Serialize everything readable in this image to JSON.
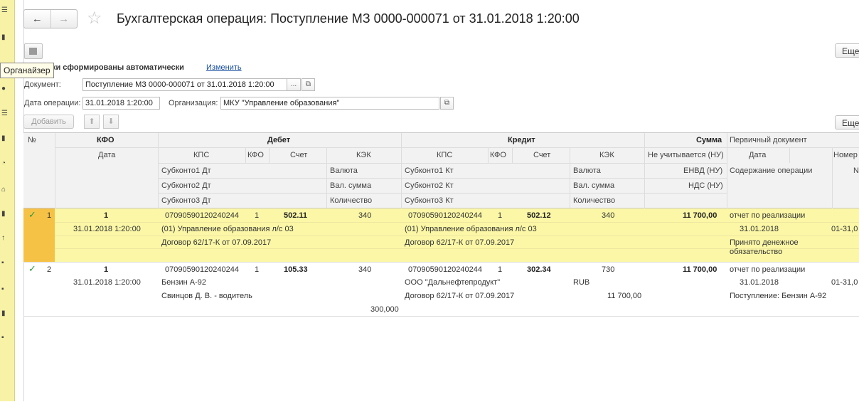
{
  "header": {
    "title": "Бухгалтерская операция: Поступление МЗ 0000-000071 от 31.01.2018 1:20:00",
    "back_icon": "←",
    "forward_icon": "→",
    "star_icon": "☆",
    "more_label": "Еще"
  },
  "tooltip": "Органайзер",
  "auto_text": "дки сформированы автоматически",
  "change_link": "Изменить",
  "form": {
    "document_label": "Документ:",
    "document_value": "Поступление МЗ 0000-000071 от 31.01.2018 1:20:00",
    "ellipsis": "...",
    "open_icon": "⧉",
    "date_label": "Дата операции:",
    "date_value": "31.01.2018  1:20:00",
    "org_label": "Организация:",
    "org_value": "МКУ \"Управление образования\""
  },
  "toolbar": {
    "add_label": "Добавить",
    "up_icon": "⬆",
    "down_icon": "⬇",
    "more_label": "Еще"
  },
  "columns": {
    "num": "№",
    "kfo": "КФО",
    "date": "Дата",
    "debit": "Дебет",
    "credit": "Кредит",
    "sum": "Сумма",
    "primary_doc": "Первичный документ",
    "kps": "КПС",
    "kfo_short": "КФО",
    "account": "Счет",
    "kek": "КЭК",
    "sub1_dt": "Субконто1 Дт",
    "sub2_dt": "Субконто2 Дт",
    "sub3_dt": "Субконто3 Дт",
    "sub1_kt": "Субконто1 Кт",
    "sub2_kt": "Субконто2 Кт",
    "sub3_kt": "Субконто3 Кт",
    "currency": "Валюта",
    "cur_sum": "Вал. сумма",
    "quantity": "Количество",
    "not_counted": "Не учитывается (НУ)",
    "envd": "ЕНВД (НУ)",
    "vat": "НДС (НУ)",
    "pd_date": "Дата",
    "pd_number": "Номер",
    "op_content": "Содержание операции",
    "n_short": "N"
  },
  "rows": [
    {
      "check": "✓",
      "num": "1",
      "kfo": "1",
      "date": "31.01.2018 1:20:00",
      "dt_kps": "07090590120240244",
      "dt_kfo": "1",
      "dt_account": "502.11",
      "dt_kek": "340",
      "dt_sub1": "(01) Управление образования л/с 03",
      "dt_sub2": "Договор 62/17-К от 07.09.2017",
      "dt_sub3": "",
      "dt_currency": "",
      "dt_cur_sum": "",
      "dt_quantity": "",
      "kt_kps": "07090590120240244",
      "kt_kfo": "1",
      "kt_account": "502.12",
      "kt_kek": "340",
      "kt_sub1": "(01) Управление образования л/с 03",
      "kt_sub2": "Договор 62/17-К от 07.09.2017",
      "kt_sub3": "",
      "kt_currency": "",
      "kt_cur_sum": "",
      "kt_quantity": "",
      "sum": "11 700,00",
      "pd_doc": "отчет по реализации",
      "pd_date": "31.01.2018",
      "pd_number": "01-31,0",
      "content1": "Принято денежное",
      "content2": "обязательство"
    },
    {
      "check": "✓",
      "num": "2",
      "kfo": "1",
      "date": "31.01.2018 1:20:00",
      "dt_kps": "07090590120240244",
      "dt_kfo": "1",
      "dt_account": "105.33",
      "dt_kek": "340",
      "dt_sub1": "Бензин А-92",
      "dt_sub2": "Свинцов Д. В. - водитель",
      "dt_quantity": "300,000",
      "kt_kps": "07090590120240244",
      "kt_kfo": "1",
      "kt_account": "302.34",
      "kt_kek": "730",
      "kt_sub1": "ООО \"Дальнефтепродукт\"",
      "kt_sub2": "Договор 62/17-К от 07.09.2017",
      "kt_currency": "RUB",
      "kt_cur_sum": "11 700,00",
      "sum": "11 700,00",
      "pd_doc": "отчет по реализации",
      "pd_date": "31.01.2018",
      "pd_number": "01-31,0",
      "content1": "Поступление: Бензин А-92"
    }
  ]
}
